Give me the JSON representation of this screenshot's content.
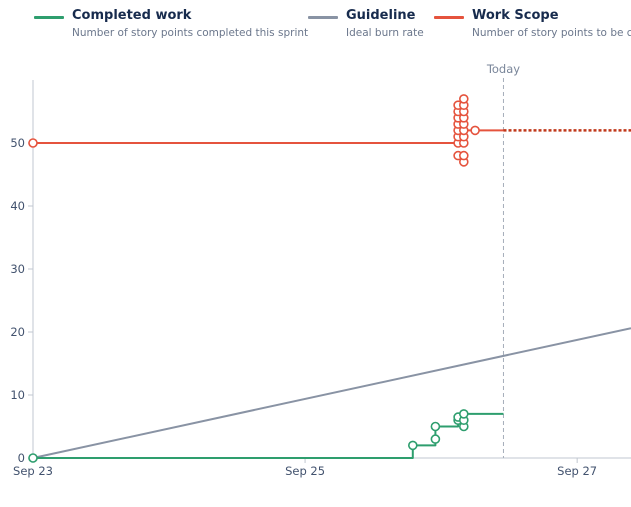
{
  "legend": [
    {
      "name": "Completed work",
      "description": "Number of story points completed this sprint",
      "color": "#2e9e6e"
    },
    {
      "name": "Guideline",
      "description": "Ideal burn rate",
      "color": "#8993a4"
    },
    {
      "name": "Work Scope",
      "description": "Number of story points to be completed",
      "color": "#e5533d"
    }
  ],
  "chart_data": {
    "type": "line",
    "title": "",
    "xlabel": "",
    "ylabel": "",
    "x_domain": [
      "2023-09-23",
      "2023-09-27 09:30"
    ],
    "ylim": [
      0,
      60
    ],
    "y_ticks": [
      0,
      10,
      20,
      30,
      40,
      50
    ],
    "x_ticks": [
      {
        "date": "2023-09-23",
        "label": "Sep 23"
      },
      {
        "date": "2023-09-25",
        "label": "Sep 25"
      },
      {
        "date": "2023-09-27",
        "label": "Sep 27"
      }
    ],
    "today": {
      "date": "2023-09-26 11:00",
      "label": "Today"
    },
    "series": [
      {
        "name": "Work Scope",
        "color": "#e5533d",
        "step_points": [
          [
            "2023-09-23 00:00",
            50
          ],
          [
            "2023-09-26 03:00",
            50
          ],
          [
            "2023-09-26 04:00",
            57
          ],
          [
            "2023-09-26 04:00",
            52
          ],
          [
            "2023-09-26 06:00",
            52
          ],
          [
            "2023-09-26 11:00",
            52
          ]
        ],
        "markers": [
          [
            "2023-09-23 00:00",
            50
          ],
          [
            "2023-09-26 03:00",
            48
          ],
          [
            "2023-09-26 03:00",
            50
          ],
          [
            "2023-09-26 03:00",
            51
          ],
          [
            "2023-09-26 03:00",
            52
          ],
          [
            "2023-09-26 03:00",
            53
          ],
          [
            "2023-09-26 03:00",
            54
          ],
          [
            "2023-09-26 03:00",
            55
          ],
          [
            "2023-09-26 03:00",
            56
          ],
          [
            "2023-09-26 04:00",
            47
          ],
          [
            "2023-09-26 04:00",
            48
          ],
          [
            "2023-09-26 04:00",
            50
          ],
          [
            "2023-09-26 04:00",
            51
          ],
          [
            "2023-09-26 04:00",
            52
          ],
          [
            "2023-09-26 04:00",
            53
          ],
          [
            "2023-09-26 04:00",
            54
          ],
          [
            "2023-09-26 04:00",
            55
          ],
          [
            "2023-09-26 04:00",
            56
          ],
          [
            "2023-09-26 04:00",
            57
          ],
          [
            "2023-09-26 06:00",
            52
          ]
        ],
        "projection": {
          "from": [
            "2023-09-26 11:00",
            52
          ],
          "to": [
            "2023-09-27 09:30",
            52
          ]
        }
      },
      {
        "name": "Guideline",
        "color": "#8993a4",
        "points": [
          [
            "2023-09-23 00:00",
            0
          ],
          [
            "2023-09-27 09:30",
            20.6
          ]
        ]
      },
      {
        "name": "Completed work",
        "color": "#2e9e6e",
        "step_points": [
          [
            "2023-09-23 00:00",
            0
          ],
          [
            "2023-09-25 19:00",
            0
          ],
          [
            "2023-09-25 19:00",
            2
          ],
          [
            "2023-09-25 23:00",
            2
          ],
          [
            "2023-09-25 23:00",
            5
          ],
          [
            "2023-09-26 03:00",
            5
          ],
          [
            "2023-09-26 03:00",
            6.5
          ],
          [
            "2023-09-26 04:00",
            6.5
          ],
          [
            "2023-09-26 04:00",
            7
          ],
          [
            "2023-09-26 11:00",
            7
          ]
        ],
        "markers": [
          [
            "2023-09-23 00:00",
            0
          ],
          [
            "2023-09-25 19:00",
            2
          ],
          [
            "2023-09-25 23:00",
            3
          ],
          [
            "2023-09-25 23:00",
            5
          ],
          [
            "2023-09-26 03:00",
            6
          ],
          [
            "2023-09-26 03:00",
            6.5
          ],
          [
            "2023-09-26 04:00",
            5
          ],
          [
            "2023-09-26 04:00",
            6
          ],
          [
            "2023-09-26 04:00",
            7
          ]
        ]
      }
    ]
  },
  "style": {
    "axis_color": "#c1c7d0",
    "today_line_color": "#a5adba",
    "marker_fill": "#ffffff"
  }
}
